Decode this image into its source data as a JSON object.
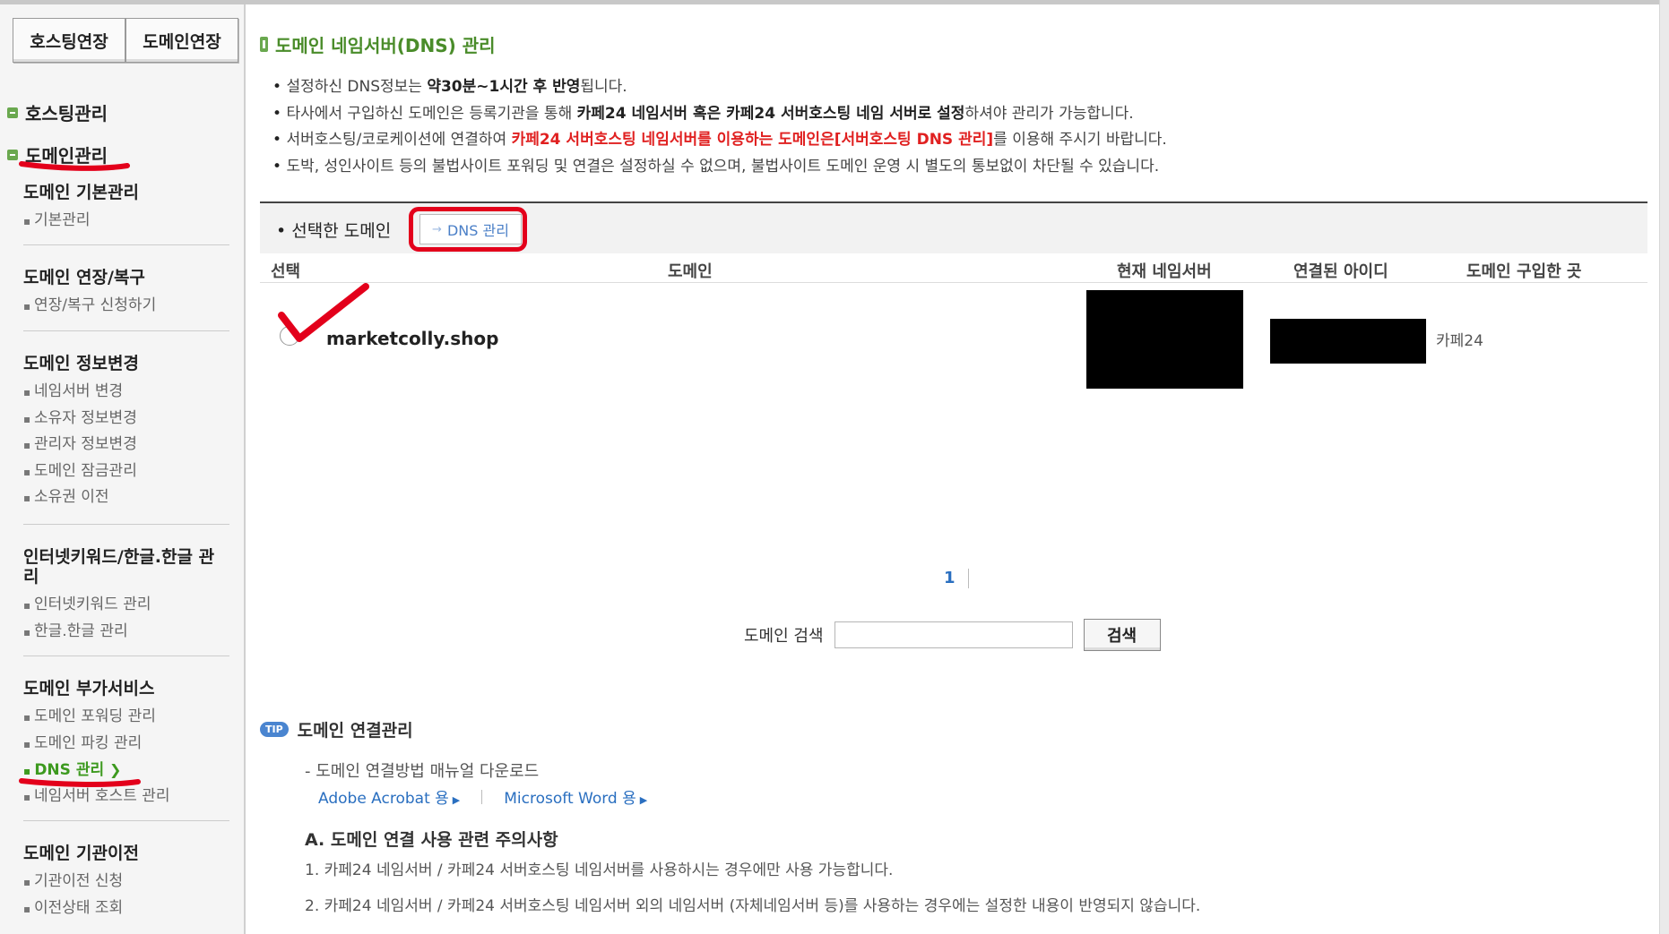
{
  "sidebar": {
    "ext_buttons": [
      "호스팅연장",
      "도메인연장"
    ],
    "sections": [
      "호스팅관리",
      "도메인관리"
    ],
    "groups": [
      {
        "title": "도메인 기본관리",
        "items": [
          "기본관리"
        ]
      },
      {
        "title": "도메인 연장/복구",
        "items": [
          "연장/복구 신청하기"
        ]
      },
      {
        "title": "도메인 정보변경",
        "items": [
          "네임서버 변경",
          "소유자 정보변경",
          "관리자 정보변경",
          "도메인 잠금관리",
          "소유권 이전"
        ]
      },
      {
        "title": "인터넷키워드/한글.한글 관리",
        "items": [
          "인터넷키워드 관리",
          "한글.한글 관리"
        ]
      },
      {
        "title": "도메인 부가서비스",
        "items": [
          "도메인 포워딩 관리",
          "도메인 파킹 관리",
          "DNS 관리",
          "네임서버 호스트 관리"
        ]
      },
      {
        "title": "도메인 기관이전",
        "items": [
          "기관이전 신청",
          "이전상태 조회"
        ]
      }
    ],
    "active_item": "DNS 관리"
  },
  "page": {
    "title": "도메인 네임서버(DNS) 관리",
    "notes": [
      {
        "a": "설정하신 DNS정보는 ",
        "b": "약30분~1시간 후 반영",
        "c": "됩니다."
      },
      {
        "a": "타사에서 구입하신 도메인은 등록기관을 통해 ",
        "b": "카페24 네임서버 혹은 카페24 서버호스팅 네임 서버로 설정",
        "c": "하셔야 관리가 가능합니다."
      },
      {
        "a": "서버호스팅/코로케이션에 연결하여 ",
        "r": "카페24 서버호스팅 네임서버를 이용하는 도메인은[서버호스팅 DNS 관리]",
        "c": "를 이용해 주시기 바랍니다."
      },
      {
        "a": "도박, 성인사이트 등의 불법사이트 포워딩 및 연결은 설정하실 수 없으며, 불법사이트 도메인 운영 시 별도의 통보없이 차단될 수 있습니다."
      }
    ],
    "selected_label": "선택한 도메인",
    "dns_button": "DNS 관리",
    "table": {
      "headers": [
        "선택",
        "도메인",
        "현재 네임서버",
        "연결된 아이디",
        "도메인 구입한 곳"
      ],
      "rows": [
        {
          "domain": "marketcolly.shop",
          "nameserver": "",
          "account": "",
          "registrar": "카페24"
        }
      ]
    },
    "pagination": "1",
    "search": {
      "label": "도메인 검색",
      "value": "",
      "button": "검색"
    },
    "tip": {
      "badge": "TIP",
      "title": "도메인 연결관리",
      "manual": "- 도메인 연결방법 매뉴얼 다운로드",
      "links": [
        "Adobe Acrobat 용",
        "Microsoft Word 용"
      ],
      "section_a": "A. 도메인 연결 사용 관련 주의사항",
      "paragraphs": [
        "1. 카페24 네임서버 / 카페24 서버호스팅 네임서버를 사용하시는 경우에만 사용 가능합니다.",
        "2. 카페24 네임서버 / 카페24 서버호스팅 네임서버 외의 네임서버 (자체네임서버 등)를 사용하는 경우에는 설정한 내용이 반영되지 않습니다."
      ]
    }
  },
  "colors": {
    "accent_green": "#4a8c2a",
    "link_blue": "#2a6fc0",
    "warning_red": "#e02020",
    "annotation_red": "#e3001b"
  }
}
